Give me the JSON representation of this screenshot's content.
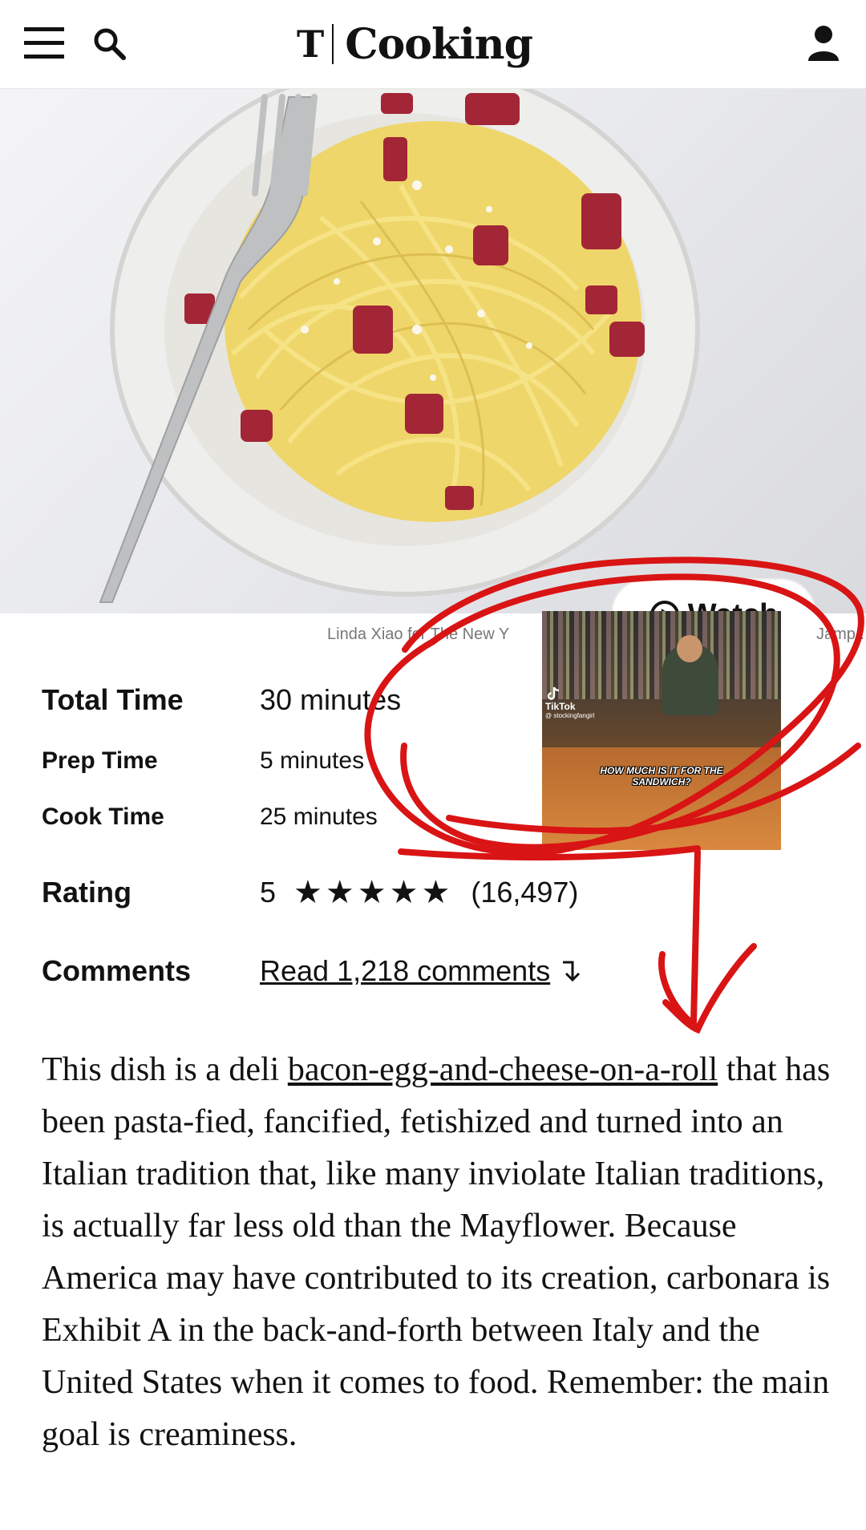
{
  "header": {
    "logo_mark": "T",
    "logo_text": "Cooking",
    "icons": [
      "menu-icon",
      "search-icon",
      "user-icon"
    ]
  },
  "hero": {
    "watch_label": "Watch",
    "credit": "Linda Xiao for The New Y",
    "credit_tail": "Jamp..."
  },
  "info": {
    "total_time_label": "Total Time",
    "total_time_value": "30 minutes",
    "prep_time_label": "Prep Time",
    "prep_time_value": "5 minutes",
    "cook_time_label": "Cook Time",
    "cook_time_value": "25 minutes",
    "rating_label": "Rating",
    "rating_value": "5",
    "rating_stars": 5,
    "rating_count": "(16,497)",
    "comments_label": "Comments",
    "comments_link": "Read 1,218 comments"
  },
  "description": {
    "prefix": "This dish is a deli ",
    "link": "bacon-egg-and-cheese-on-a-roll",
    "body": " that has been pasta-fied, fancified, fetishized and turned into an Italian tradition that, like many inviolate Italian traditions, is actually far less old than the Mayflower. Because America may have contributed to its creation, carbonara is Exhibit A in the back-and-forth between Italy and the United States when it comes to food. Remember: the main goal is creaminess."
  },
  "tiktok": {
    "brand": "TikTok",
    "handle": "@ stockingfangirl",
    "caption": "HOW MUCH IS IT FOR THE SANDWICH?"
  },
  "colors": {
    "annotation": "#d91414",
    "text": "#121212",
    "muted": "#777777"
  }
}
